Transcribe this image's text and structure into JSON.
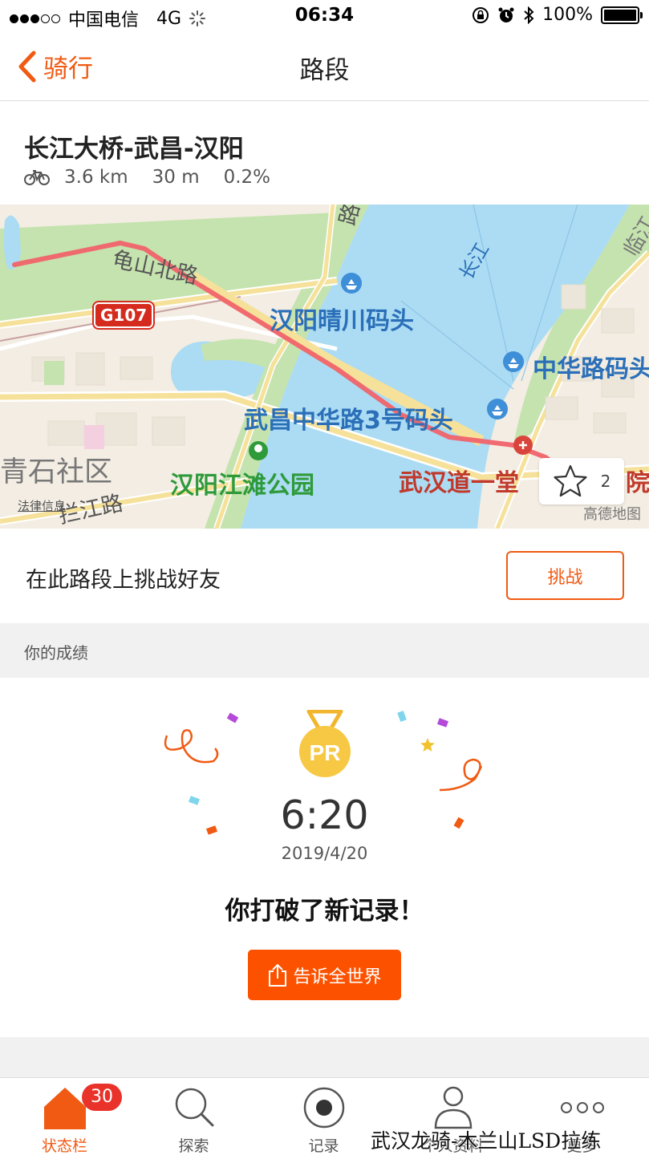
{
  "status_bar": {
    "carrier": "中国电信",
    "network": "4G",
    "time": "06:34",
    "battery": "100%"
  },
  "nav": {
    "back_label": "骑行",
    "title": "路段"
  },
  "segment": {
    "name": "长江大桥-武昌-汉阳",
    "distance": "3.6 km",
    "elevation": "30 m",
    "grade": "0.2%"
  },
  "map": {
    "labels": {
      "road_guishan": "龟山北路",
      "road_lanjiang": "拦江路",
      "highway": "G107",
      "pier_qingchuan": "汉阳晴川码头",
      "pier_zhonghua": "中华路码头",
      "pier_wuchang": "武昌中华路3号码头",
      "park": "汉阳江滩公园",
      "hospital": "武汉道一堂",
      "hospital_tail": "院",
      "community": "青石社区",
      "river": "长江",
      "district": "临江",
      "partial_top": "路",
      "law_info": "法律信息",
      "provider": "高德地图"
    },
    "star_count": "2"
  },
  "challenge": {
    "text": "在此路段上挑战好友",
    "button": "挑战"
  },
  "section_title": "你的成绩",
  "result": {
    "medal_text": "PR",
    "time": "6:20",
    "date": "2019/4/20",
    "message": "你打破了新记录！",
    "share_button": "告诉全世界"
  },
  "tabs": [
    {
      "label": "状态栏",
      "badge": "30"
    },
    {
      "label": "探索"
    },
    {
      "label": "记录"
    },
    {
      "label": "个人资料"
    },
    {
      "label": "更多"
    }
  ],
  "watermark": "武汉龙骑-木兰山LSD拉练",
  "colors": {
    "accent": "#f05a13",
    "share_button": "#fc5200",
    "badge": "#e8322a",
    "water": "#abdcf3",
    "route": "#f0636a"
  }
}
